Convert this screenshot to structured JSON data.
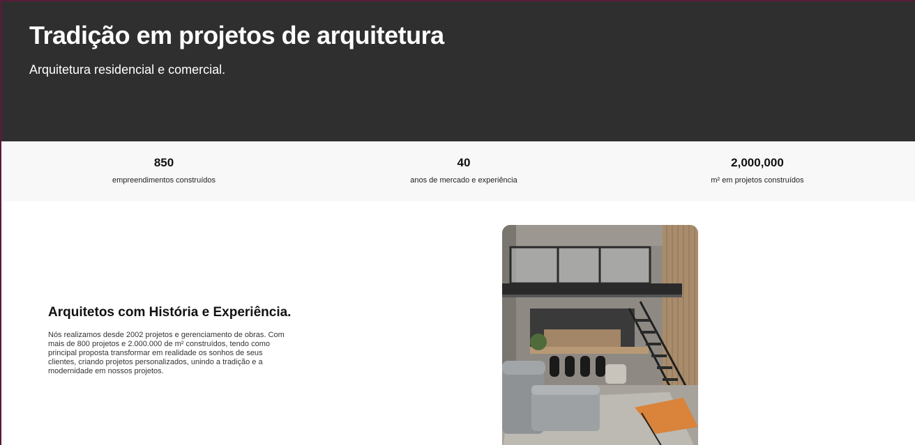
{
  "hero": {
    "title": "Tradição em projetos de arquitetura",
    "subtitle": "Arquitetura residencial e comercial."
  },
  "stats": [
    {
      "value": "850",
      "label": "empreendimentos construídos"
    },
    {
      "value": "40",
      "label": "anos de mercado e experiência"
    },
    {
      "value": "2,000,000",
      "label": "m² em projetos construídos"
    }
  ],
  "about": {
    "title": "Arquitetos com História e Experiência.",
    "text": "Nós realizamos desde 2002 projetos e gerenciamento de obras. Com mais de 800 projetos e 2.000.000 de m² construídos, tendo como principal proposta transformar em realidade os sonhos de seus clientes, criando projetos personalizados, unindo a tradição e a modernidade em nossos projetos."
  },
  "photo": {
    "subject": "loft-interior-photo"
  },
  "colors": {
    "hero_bg": "#2f2f2f",
    "stats_bg": "#f8f8f8",
    "text_dark": "#111111"
  }
}
